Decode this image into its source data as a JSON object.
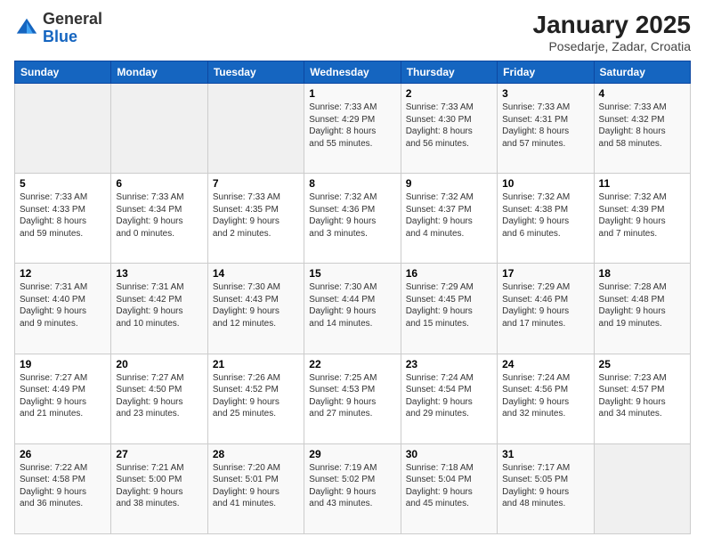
{
  "header": {
    "logo_general": "General",
    "logo_blue": "Blue",
    "month_year": "January 2025",
    "location": "Posedarje, Zadar, Croatia"
  },
  "days_of_week": [
    "Sunday",
    "Monday",
    "Tuesday",
    "Wednesday",
    "Thursday",
    "Friday",
    "Saturday"
  ],
  "weeks": [
    [
      {
        "day": "",
        "info": ""
      },
      {
        "day": "",
        "info": ""
      },
      {
        "day": "",
        "info": ""
      },
      {
        "day": "1",
        "info": "Sunrise: 7:33 AM\nSunset: 4:29 PM\nDaylight: 8 hours\nand 55 minutes."
      },
      {
        "day": "2",
        "info": "Sunrise: 7:33 AM\nSunset: 4:30 PM\nDaylight: 8 hours\nand 56 minutes."
      },
      {
        "day": "3",
        "info": "Sunrise: 7:33 AM\nSunset: 4:31 PM\nDaylight: 8 hours\nand 57 minutes."
      },
      {
        "day": "4",
        "info": "Sunrise: 7:33 AM\nSunset: 4:32 PM\nDaylight: 8 hours\nand 58 minutes."
      }
    ],
    [
      {
        "day": "5",
        "info": "Sunrise: 7:33 AM\nSunset: 4:33 PM\nDaylight: 8 hours\nand 59 minutes."
      },
      {
        "day": "6",
        "info": "Sunrise: 7:33 AM\nSunset: 4:34 PM\nDaylight: 9 hours\nand 0 minutes."
      },
      {
        "day": "7",
        "info": "Sunrise: 7:33 AM\nSunset: 4:35 PM\nDaylight: 9 hours\nand 2 minutes."
      },
      {
        "day": "8",
        "info": "Sunrise: 7:32 AM\nSunset: 4:36 PM\nDaylight: 9 hours\nand 3 minutes."
      },
      {
        "day": "9",
        "info": "Sunrise: 7:32 AM\nSunset: 4:37 PM\nDaylight: 9 hours\nand 4 minutes."
      },
      {
        "day": "10",
        "info": "Sunrise: 7:32 AM\nSunset: 4:38 PM\nDaylight: 9 hours\nand 6 minutes."
      },
      {
        "day": "11",
        "info": "Sunrise: 7:32 AM\nSunset: 4:39 PM\nDaylight: 9 hours\nand 7 minutes."
      }
    ],
    [
      {
        "day": "12",
        "info": "Sunrise: 7:31 AM\nSunset: 4:40 PM\nDaylight: 9 hours\nand 9 minutes."
      },
      {
        "day": "13",
        "info": "Sunrise: 7:31 AM\nSunset: 4:42 PM\nDaylight: 9 hours\nand 10 minutes."
      },
      {
        "day": "14",
        "info": "Sunrise: 7:30 AM\nSunset: 4:43 PM\nDaylight: 9 hours\nand 12 minutes."
      },
      {
        "day": "15",
        "info": "Sunrise: 7:30 AM\nSunset: 4:44 PM\nDaylight: 9 hours\nand 14 minutes."
      },
      {
        "day": "16",
        "info": "Sunrise: 7:29 AM\nSunset: 4:45 PM\nDaylight: 9 hours\nand 15 minutes."
      },
      {
        "day": "17",
        "info": "Sunrise: 7:29 AM\nSunset: 4:46 PM\nDaylight: 9 hours\nand 17 minutes."
      },
      {
        "day": "18",
        "info": "Sunrise: 7:28 AM\nSunset: 4:48 PM\nDaylight: 9 hours\nand 19 minutes."
      }
    ],
    [
      {
        "day": "19",
        "info": "Sunrise: 7:27 AM\nSunset: 4:49 PM\nDaylight: 9 hours\nand 21 minutes."
      },
      {
        "day": "20",
        "info": "Sunrise: 7:27 AM\nSunset: 4:50 PM\nDaylight: 9 hours\nand 23 minutes."
      },
      {
        "day": "21",
        "info": "Sunrise: 7:26 AM\nSunset: 4:52 PM\nDaylight: 9 hours\nand 25 minutes."
      },
      {
        "day": "22",
        "info": "Sunrise: 7:25 AM\nSunset: 4:53 PM\nDaylight: 9 hours\nand 27 minutes."
      },
      {
        "day": "23",
        "info": "Sunrise: 7:24 AM\nSunset: 4:54 PM\nDaylight: 9 hours\nand 29 minutes."
      },
      {
        "day": "24",
        "info": "Sunrise: 7:24 AM\nSunset: 4:56 PM\nDaylight: 9 hours\nand 32 minutes."
      },
      {
        "day": "25",
        "info": "Sunrise: 7:23 AM\nSunset: 4:57 PM\nDaylight: 9 hours\nand 34 minutes."
      }
    ],
    [
      {
        "day": "26",
        "info": "Sunrise: 7:22 AM\nSunset: 4:58 PM\nDaylight: 9 hours\nand 36 minutes."
      },
      {
        "day": "27",
        "info": "Sunrise: 7:21 AM\nSunset: 5:00 PM\nDaylight: 9 hours\nand 38 minutes."
      },
      {
        "day": "28",
        "info": "Sunrise: 7:20 AM\nSunset: 5:01 PM\nDaylight: 9 hours\nand 41 minutes."
      },
      {
        "day": "29",
        "info": "Sunrise: 7:19 AM\nSunset: 5:02 PM\nDaylight: 9 hours\nand 43 minutes."
      },
      {
        "day": "30",
        "info": "Sunrise: 7:18 AM\nSunset: 5:04 PM\nDaylight: 9 hours\nand 45 minutes."
      },
      {
        "day": "31",
        "info": "Sunrise: 7:17 AM\nSunset: 5:05 PM\nDaylight: 9 hours\nand 48 minutes."
      },
      {
        "day": "",
        "info": ""
      }
    ]
  ]
}
